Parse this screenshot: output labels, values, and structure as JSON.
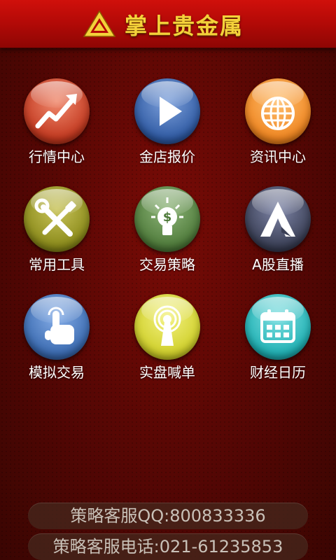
{
  "header": {
    "title": "掌上贵金属"
  },
  "grid": {
    "items": [
      {
        "label": "行情中心",
        "icon": "trend-up-icon",
        "color": "#e0553a"
      },
      {
        "label": "金店报价",
        "icon": "play-icon",
        "color": "#3f64a8"
      },
      {
        "label": "资讯中心",
        "icon": "globe-icon",
        "color": "#f08a28"
      },
      {
        "label": "常用工具",
        "icon": "tools-icon",
        "color": "#8a8a1a"
      },
      {
        "label": "交易策略",
        "icon": "lightbulb-icon",
        "color": "#4e7a3a"
      },
      {
        "label": "A股直播",
        "icon": "letter-a-icon",
        "color": "#3a3f55"
      },
      {
        "label": "模拟交易",
        "icon": "touch-hand-icon",
        "color": "#3a6ab0"
      },
      {
        "label": "实盘喊单",
        "icon": "broadcast-icon",
        "color": "#cfcf2a"
      },
      {
        "label": "财经日历",
        "icon": "calendar-icon",
        "color": "#1fb0b3"
      }
    ]
  },
  "footer": {
    "qq": "策略客服QQ:800833336",
    "phone": "策略客服电话:021-61235853"
  }
}
